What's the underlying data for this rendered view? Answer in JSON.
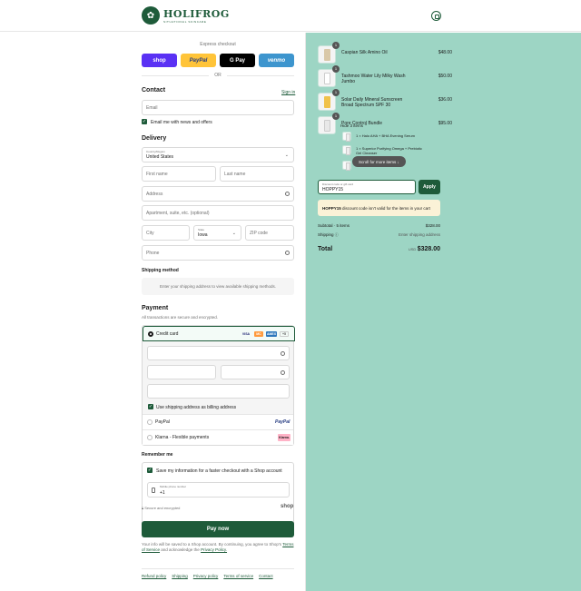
{
  "header": {
    "brand": "HOLIFROG",
    "tagline": "SITUATIONAL SKINCARE"
  },
  "express": {
    "title": "Express checkout",
    "wallets": [
      "shop",
      "PayPal",
      "G Pay",
      "venmo"
    ],
    "or": "OR"
  },
  "contact": {
    "heading": "Contact",
    "sign_in": "Sign in",
    "email_placeholder": "Email",
    "news_label": "Email me with news and offers"
  },
  "delivery": {
    "heading": "Delivery",
    "country_label": "Country/Region",
    "country_value": "United States",
    "first_name": "First name",
    "last_name": "Last name",
    "address": "Address",
    "apartment": "Apartment, suite, etc. (optional)",
    "city": "City",
    "state_label": "State",
    "state_value": "Iowa",
    "zip": "ZIP code",
    "phone": "Phone"
  },
  "shipping": {
    "heading": "Shipping method",
    "message": "Enter your shipping address to view available shipping methods."
  },
  "payment": {
    "heading": "Payment",
    "subtitle": "All transactions are secure and encrypted.",
    "credit_card": "Credit card",
    "card_logos": [
      "VISA",
      "MC",
      "AMEX",
      "+5"
    ],
    "billing_label": "Use shipping address as billing address",
    "paypal": "PayPal",
    "paypal_logo": "PayPal",
    "klarna": "Klarna - Flexible payments",
    "klarna_logo": "Klarna."
  },
  "remember": {
    "heading": "Remember me",
    "save_label": "Save my information for a faster checkout with a Shop account",
    "phone_label": "Mobile phone number",
    "phone_value": "+1",
    "secure": "Secure and encrypted",
    "shop": "shop"
  },
  "pay_now": "Pay now",
  "legal": {
    "text1": "Your info will be saved to a Shop account. By continuing, you agree to Shop's",
    "terms": "Terms of Service",
    "text2": "and acknowledge the",
    "privacy": "Privacy Policy."
  },
  "footer": [
    "Refund policy",
    "Shipping",
    "Privacy policy",
    "Terms of service",
    "Contact"
  ],
  "cart": {
    "items": [
      {
        "qty": "1",
        "name": "Caspian Silk Amino Oil",
        "price": "$48.00",
        "color": "#d9c8a8"
      },
      {
        "qty": "1",
        "name": "Tashmoo Water Lily Milky Wash Jumbo",
        "price": "$50.00",
        "color": "#ffffff"
      },
      {
        "qty": "1",
        "name": "Solar Daily Mineral Sunscreen Broad Spectrum SPF 30",
        "price": "$36.00",
        "color": "#f0c24a"
      },
      {
        "qty": "1",
        "name": "Pore Control Bundle",
        "price": "$95.00",
        "color": "#e8e8e8"
      }
    ],
    "hide_items": "Hide 3 items",
    "sub_items": [
      "1 × Halo AHA + BHA Evening Serum",
      "1 × Superior Purifying Omega + Prebiotic Gel Cleanser"
    ],
    "scroll_more": "Scroll for more items",
    "discount_label": "Discount code or gift card",
    "discount_value": "HOPPY15",
    "apply": "Apply",
    "warning_code": "HOPPY15",
    "warning_text": "discount code isn't valid for the items in your cart",
    "subtotal_label": "Subtotal · 5 items",
    "subtotal_value": "$328.00",
    "shipping_label": "Shipping",
    "shipping_value": "Enter shipping address",
    "total_label": "Total",
    "currency": "USD",
    "total_value": "$328.00"
  }
}
